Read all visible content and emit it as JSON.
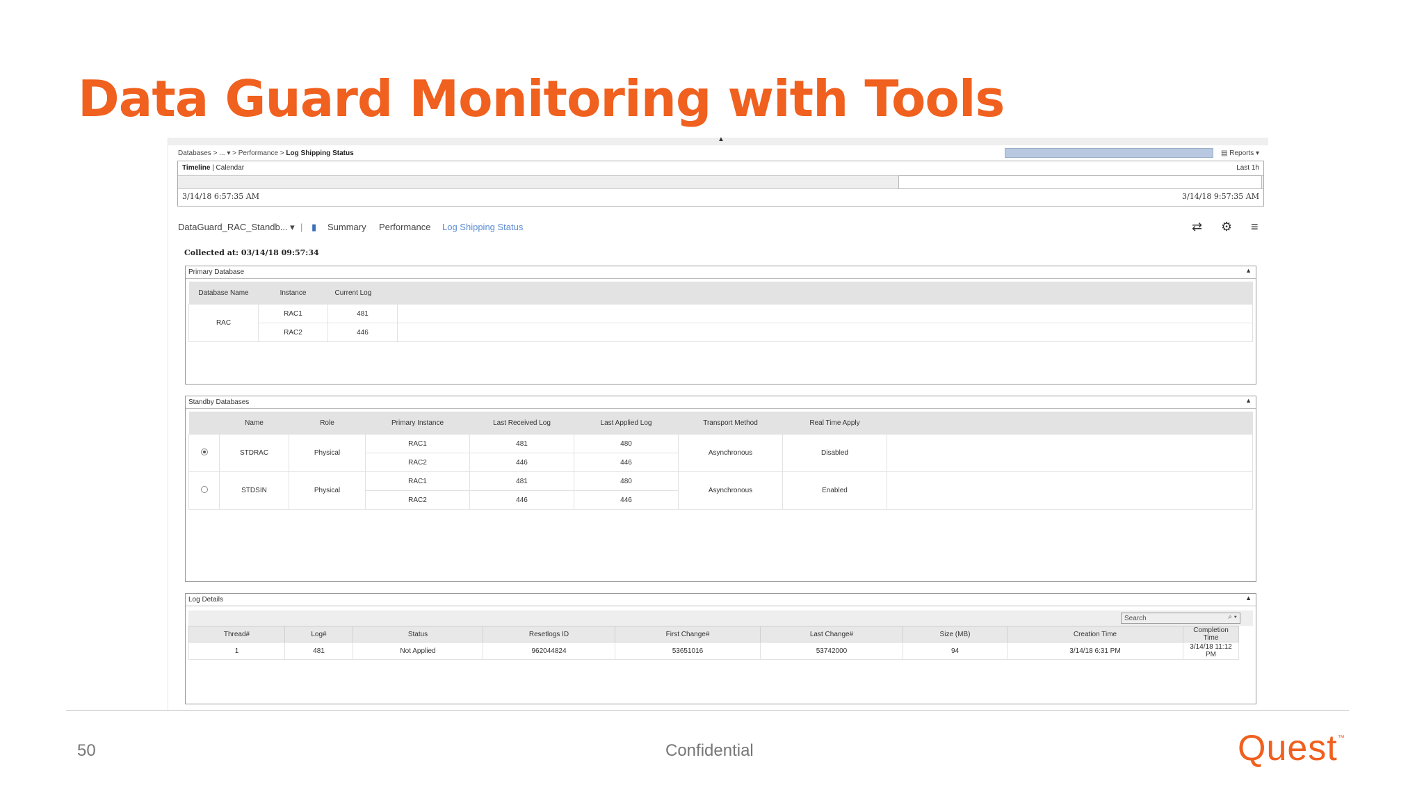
{
  "slide": {
    "title": "Data Guard Monitoring with Tools",
    "page_number": "50",
    "footer_label": "Confidential",
    "logo_text": "Quest"
  },
  "breadcrumb": {
    "root": "Databases",
    "sep": ">",
    "middle": "...",
    "section": "Performance",
    "current": "Log Shipping Status"
  },
  "reports_label": "Reports",
  "timeline": {
    "tab_timeline": "Timeline",
    "tab_calendar": "Calendar",
    "range_label": "Last 1h",
    "start_time": "3/14/18 6:57:35 AM",
    "end_time": "3/14/18 9:57:35 AM"
  },
  "navbar": {
    "instance": "DataGuard_RAC_Standb...",
    "tabs": [
      "Summary",
      "Performance",
      "Log Shipping Status"
    ],
    "active_tab": "Log Shipping Status"
  },
  "collected_at": "Collected at: 03/14/18 09:57:34",
  "primary": {
    "title": "Primary Database",
    "headers": [
      "Database Name",
      "Instance",
      "Current Log"
    ],
    "database": "RAC",
    "rows": [
      {
        "instance": "RAC1",
        "current_log": "481"
      },
      {
        "instance": "RAC2",
        "current_log": "446"
      }
    ]
  },
  "standby": {
    "title": "Standby Databases",
    "headers": [
      "Name",
      "Role",
      "Primary Instance",
      "Last Received Log",
      "Last Applied Log",
      "Transport Method",
      "Real Time Apply"
    ],
    "databases": [
      {
        "name": "STDRAC",
        "role": "Physical",
        "selected": true,
        "transport": "Asynchronous",
        "rta": "Disabled",
        "rows": [
          {
            "instance": "RAC1",
            "received": "481",
            "applied": "480"
          },
          {
            "instance": "RAC2",
            "received": "446",
            "applied": "446"
          }
        ]
      },
      {
        "name": "STDSIN",
        "role": "Physical",
        "selected": false,
        "transport": "Asynchronous",
        "rta": "Enabled",
        "rows": [
          {
            "instance": "RAC1",
            "received": "481",
            "applied": "480"
          },
          {
            "instance": "RAC2",
            "received": "446",
            "applied": "446"
          }
        ]
      }
    ]
  },
  "log_details": {
    "title": "Log Details",
    "search_placeholder": "Search",
    "headers": [
      "Thread#",
      "Log#",
      "Status",
      "Resetlogs ID",
      "First Change#",
      "Last Change#",
      "Size (MB)",
      "Creation Time",
      "Completion Time"
    ],
    "rows": [
      [
        "1",
        "481",
        "Not Applied",
        "962044824",
        "53651016",
        "53742000",
        "94",
        "3/14/18 6:31 PM",
        "3/14/18 11:12 PM"
      ]
    ]
  }
}
